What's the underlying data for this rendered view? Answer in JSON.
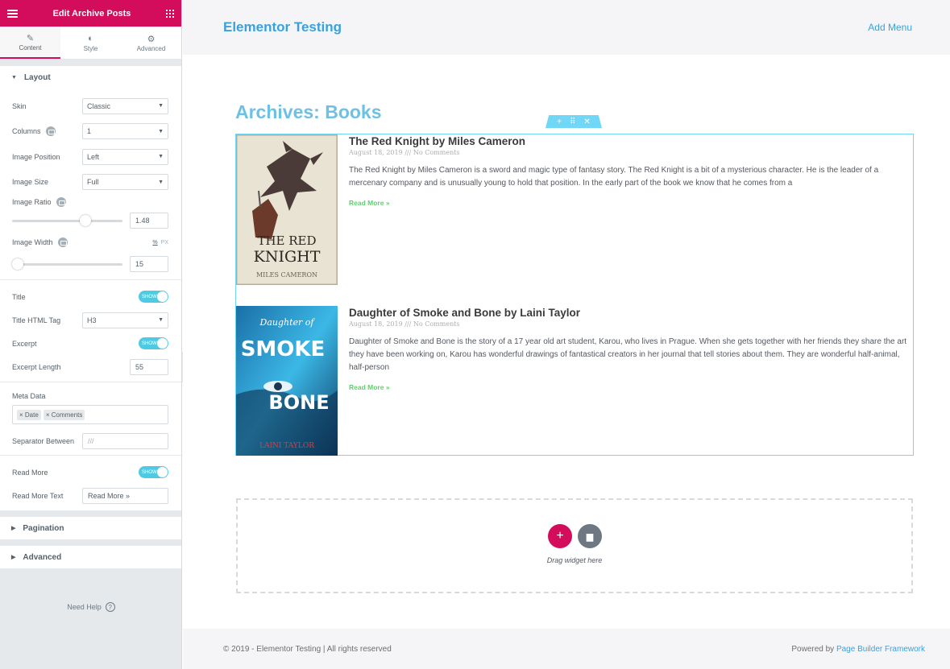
{
  "editor": {
    "header_title": "Edit Archive Posts",
    "tabs": [
      {
        "label": "Content",
        "icon": "pencil-icon"
      },
      {
        "label": "Style",
        "icon": "half-circle-icon"
      },
      {
        "label": "Advanced",
        "icon": "gear-icon"
      }
    ],
    "section_layout": "Layout",
    "controls": {
      "skin": {
        "label": "Skin",
        "value": "Classic"
      },
      "columns": {
        "label": "Columns",
        "value": "1"
      },
      "image_position": {
        "label": "Image Position",
        "value": "Left"
      },
      "image_size": {
        "label": "Image Size",
        "value": "Full"
      },
      "image_ratio": {
        "label": "Image Ratio",
        "value": "1.48",
        "slider_fraction": 0.68
      },
      "image_width": {
        "label": "Image Width",
        "value": "15",
        "unit_pct": "%",
        "unit_px": "PX",
        "slider_fraction": 0.0
      },
      "title": {
        "label": "Title",
        "toggle": "SHOW"
      },
      "title_tag": {
        "label": "Title HTML Tag",
        "value": "H3"
      },
      "excerpt": {
        "label": "Excerpt",
        "toggle": "SHOW"
      },
      "excerpt_length": {
        "label": "Excerpt Length",
        "value": "55"
      },
      "meta_data": {
        "label": "Meta Data",
        "tags": [
          "Date",
          "Comments"
        ]
      },
      "separator": {
        "label": "Separator Between",
        "value": "///"
      },
      "read_more": {
        "label": "Read More",
        "toggle": "SHOW"
      },
      "read_more_text": {
        "label": "Read More Text",
        "value": "Read More »"
      }
    },
    "section_pagination": "Pagination",
    "section_advanced": "Advanced",
    "help": "Need Help"
  },
  "site": {
    "title": "Elementor Testing",
    "menu": "Add Menu",
    "archive_title": "Archives: Books",
    "posts": [
      {
        "title": "The Red Knight by Miles Cameron",
        "meta": "August 18, 2019 /// No Comments",
        "excerpt": "The Red Knight by Miles Cameron is a sword and magic type of fantasy story. The Red Knight is a bit of a mysterious character. He is the leader of a mercenary company and is unusually young to hold that position. In the early part of the book we know that he comes from a",
        "read_more": "Read More »",
        "cover": {
          "line1": "THE RED",
          "line2": "KNIGHT",
          "author": "MILES CAMERON"
        }
      },
      {
        "title": "Daughter of Smoke and Bone by Laini Taylor",
        "meta": "August 18, 2019 /// No Comments",
        "excerpt": "Daughter of Smoke and Bone is the story of a 17 year old art student, Karou, who lives in Prague.  When she gets together with her friends they share the art they have been working on,  Karou has wonderful drawings of fantastical creators in her journal that tell stories about them.  They are wonderful half-animal, half-person",
        "read_more": "Read More »",
        "cover": {
          "line1": "Daughter of",
          "line2": "SMOKE",
          "line3": "BONE",
          "author": "LAINI TAYLOR"
        }
      }
    ],
    "dropzone_text": "Drag widget here",
    "footer_left": "© 2019 - Elementor Testing | All rights reserved",
    "footer_powered": "Powered by",
    "footer_framework": "Page Builder Framework"
  },
  "colors": {
    "brand": "#d30c5c",
    "accent": "#6ec1e4",
    "link": "#3ba1da",
    "read_more": "#61ce70"
  }
}
